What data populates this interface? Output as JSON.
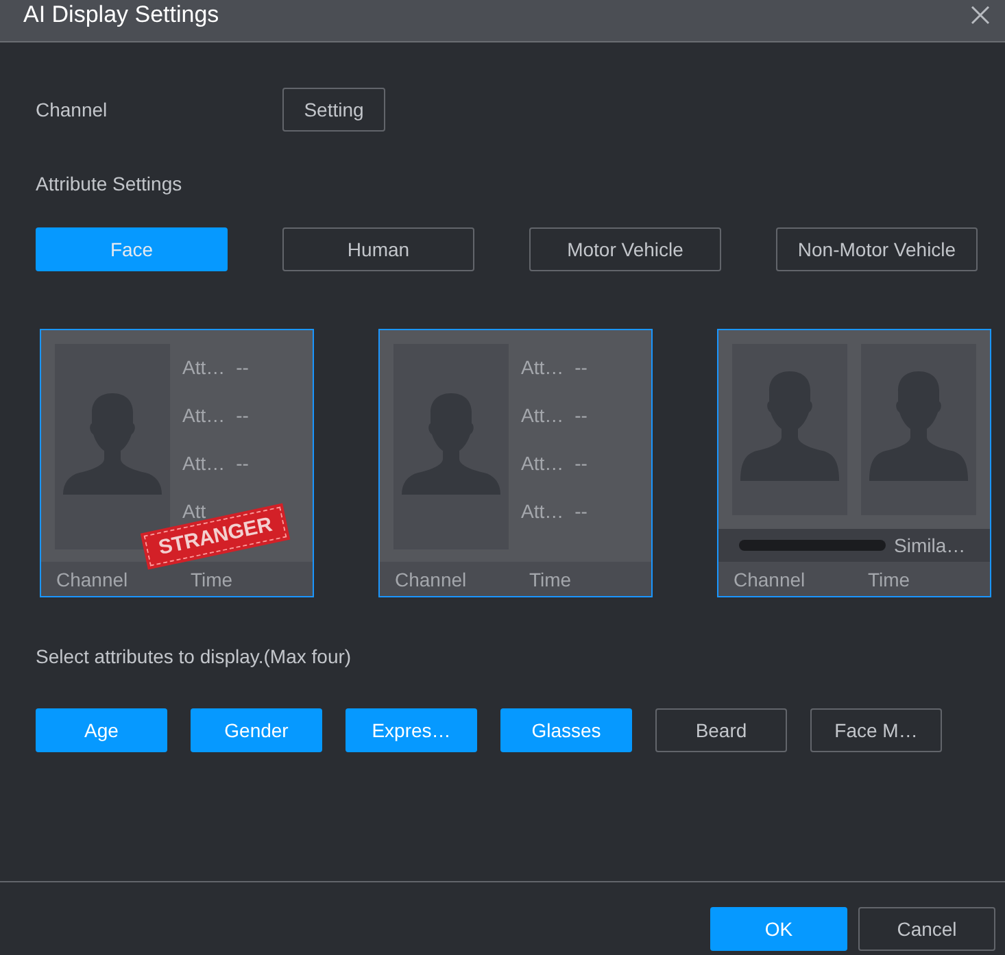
{
  "window": {
    "title": "AI Display Settings"
  },
  "channel": {
    "label": "Channel",
    "button": "Setting"
  },
  "attribute_settings": {
    "label": "Attribute Settings"
  },
  "tabs": [
    {
      "label": "Face",
      "selected": true
    },
    {
      "label": "Human",
      "selected": false
    },
    {
      "label": "Motor Vehicle",
      "selected": false
    },
    {
      "label": "Non-Motor Vehicle",
      "selected": false
    }
  ],
  "cards": [
    {
      "kind": "single",
      "attribute_names": [
        "Att…",
        "Att…",
        "Att…",
        "Att"
      ],
      "attribute_values": [
        "--",
        "--",
        "--"
      ],
      "stamp": "STRANGER",
      "footer": [
        "Channel",
        "Time"
      ]
    },
    {
      "kind": "single",
      "attribute_names": [
        "Att…",
        "Att…",
        "Att…",
        "Att…"
      ],
      "attribute_values": [
        "--",
        "--",
        "--",
        "--"
      ],
      "footer": [
        "Channel",
        "Time"
      ]
    },
    {
      "kind": "compare",
      "similarity": "Simila…",
      "footer": [
        "Channel",
        "Time"
      ]
    }
  ],
  "select_hint": "Select attributes to display.(Max four)",
  "attributes": [
    {
      "label": "Age",
      "selected": true
    },
    {
      "label": "Gender",
      "selected": true
    },
    {
      "label": "Expres…",
      "selected": true
    },
    {
      "label": "Glasses",
      "selected": true
    },
    {
      "label": "Beard",
      "selected": false
    },
    {
      "label": "Face M…",
      "selected": false
    }
  ],
  "buttons": {
    "ok": "OK",
    "cancel": "Cancel"
  }
}
